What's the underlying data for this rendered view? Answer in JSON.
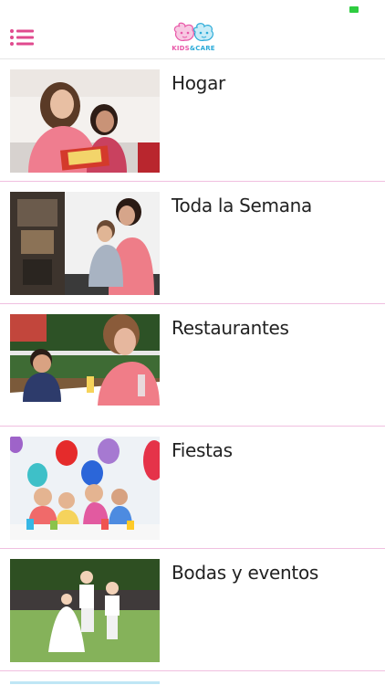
{
  "header": {
    "logo_text_kids": "KIDS",
    "logo_text_amp": "&",
    "logo_text_care": "CARE"
  },
  "items": [
    {
      "label": "Hogar",
      "photo": "photo-reading-with-child"
    },
    {
      "label": "Toda la Semana",
      "photo": "photo-play-kitchen"
    },
    {
      "label": "Restaurantes",
      "photo": "photo-restaurant-table"
    },
    {
      "label": "Fiestas",
      "photo": "photo-birthday-party"
    },
    {
      "label": "Bodas y eventos",
      "photo": "photo-wedding-children"
    }
  ],
  "colors": {
    "accent_pink": "#e04a8e",
    "divider_pink": "#f0bfe0",
    "logo_pink": "#e858a8",
    "logo_blue": "#2aaad8",
    "battery_green": "#2ecc40"
  },
  "icons": {
    "menu": "list-menu-icon",
    "logo": "kids-care-logo"
  }
}
